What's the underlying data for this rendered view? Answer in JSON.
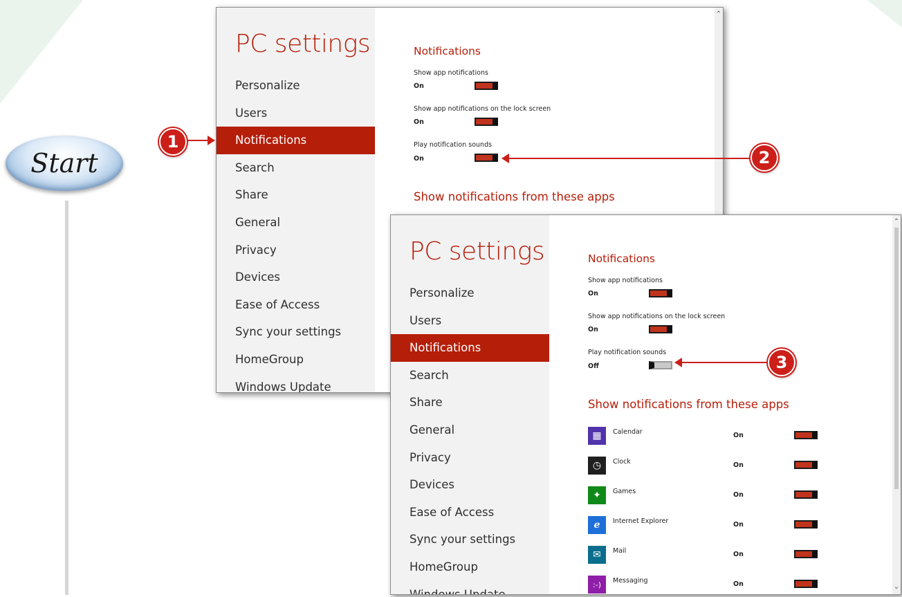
{
  "start": {
    "label": "Start"
  },
  "callouts": {
    "one": "1",
    "two": "2",
    "three": "3"
  },
  "colors": {
    "accent": "#b51e09",
    "callout": "#cc1f1a",
    "toggle_on": "#c0331c",
    "toggle_off": "#c9c9c9"
  },
  "window1": {
    "title": "PC settings",
    "nav": [
      "Personalize",
      "Users",
      "Notifications",
      "Search",
      "Share",
      "General",
      "Privacy",
      "Devices",
      "Ease of Access",
      "Sync your settings",
      "HomeGroup",
      "Windows Update"
    ],
    "active": "Notifications",
    "heading": "Notifications",
    "options": [
      {
        "label": "Show app notifications",
        "state": "On",
        "on": true
      },
      {
        "label": "Show app notifications on the lock screen",
        "state": "On",
        "on": true
      },
      {
        "label": "Play notification sounds",
        "state": "On",
        "on": true
      }
    ],
    "apps_heading": "Show notifications from these apps"
  },
  "window2": {
    "title": "PC settings",
    "nav": [
      "Personalize",
      "Users",
      "Notifications",
      "Search",
      "Share",
      "General",
      "Privacy",
      "Devices",
      "Ease of Access",
      "Sync your settings",
      "HomeGroup",
      "Windows Update"
    ],
    "active": "Notifications",
    "heading": "Notifications",
    "options": [
      {
        "label": "Show app notifications",
        "state": "On",
        "on": true
      },
      {
        "label": "Show app notifications on the lock screen",
        "state": "On",
        "on": true
      },
      {
        "label": "Play notification sounds",
        "state": "Off",
        "on": false
      }
    ],
    "apps_heading": "Show notifications from these apps",
    "apps": [
      {
        "name": "Calendar",
        "state": "On",
        "icon": "calendar-icon",
        "color": "#5133ab"
      },
      {
        "name": "Clock",
        "state": "On",
        "icon": "clock-icon",
        "color": "#1f1f1f"
      },
      {
        "name": "Games",
        "state": "On",
        "icon": "games-icon",
        "color": "#0f8a19"
      },
      {
        "name": "Internet Explorer",
        "state": "On",
        "icon": "internet-explorer-icon",
        "color": "#1e6fd9"
      },
      {
        "name": "Mail",
        "state": "On",
        "icon": "mail-icon",
        "color": "#0a6e8c"
      },
      {
        "name": "Messaging",
        "state": "On",
        "icon": "messaging-icon",
        "color": "#8e1ea8"
      }
    ]
  }
}
